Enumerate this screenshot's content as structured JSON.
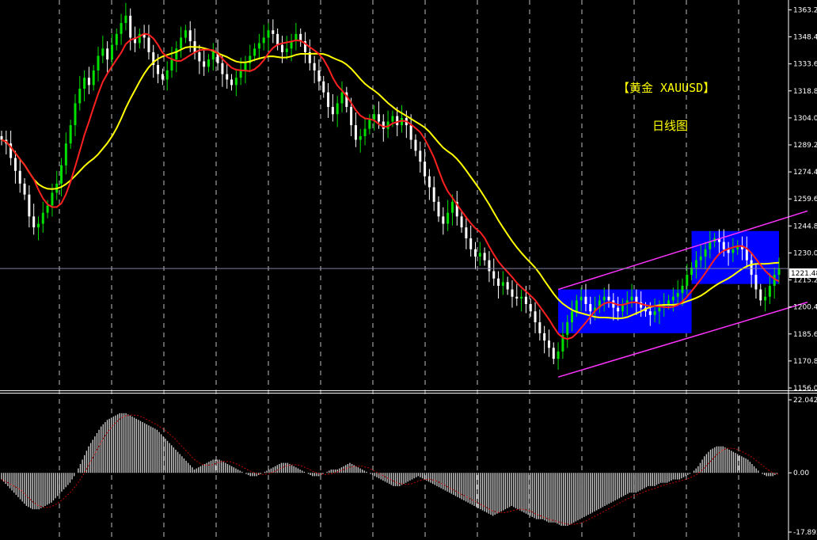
{
  "chart_data": [
    {
      "type": "candlestick",
      "title": "【黄金 XAUUSD】",
      "subtitle": "日线图",
      "y_ticks": [
        "1363.20",
        "1348.40",
        "1333.60",
        "1318.80",
        "1304.00",
        "1289.20",
        "1274.40",
        "1259.60",
        "1244.80",
        "1230.00",
        "1215.20",
        "1200.40",
        "1185.60",
        "1170.80",
        "1156.00"
      ],
      "ylim": [
        1156.0,
        1366.0
      ],
      "current_price": "1221.48",
      "close_series": [
        1292,
        1290,
        1282,
        1275,
        1268,
        1262,
        1250,
        1244,
        1246,
        1252,
        1256,
        1263,
        1268,
        1278,
        1290,
        1300,
        1312,
        1320,
        1326,
        1322,
        1330,
        1338,
        1342,
        1336,
        1344,
        1350,
        1356,
        1360,
        1348,
        1345,
        1350,
        1348,
        1340,
        1333,
        1328,
        1325,
        1330,
        1336,
        1342,
        1348,
        1352,
        1346,
        1340,
        1335,
        1332,
        1336,
        1340,
        1334,
        1328,
        1325,
        1322,
        1326,
        1330,
        1334,
        1338,
        1342,
        1345,
        1348,
        1352,
        1350,
        1344,
        1340,
        1342,
        1346,
        1350,
        1346,
        1340,
        1334,
        1330,
        1324,
        1318,
        1310,
        1306,
        1312,
        1318,
        1310,
        1300,
        1292,
        1294,
        1298,
        1303,
        1306,
        1302,
        1298,
        1302,
        1305,
        1300,
        1304,
        1300,
        1292,
        1286,
        1280,
        1272,
        1266,
        1258,
        1250,
        1246,
        1252,
        1258,
        1250,
        1244,
        1238,
        1232,
        1228,
        1230,
        1226,
        1220,
        1216,
        1212,
        1214,
        1210,
        1206,
        1205,
        1206,
        1202,
        1198,
        1192,
        1186,
        1182,
        1178,
        1172,
        1176,
        1185,
        1192,
        1198,
        1204,
        1206,
        1202,
        1198,
        1200,
        1204,
        1206,
        1204,
        1200,
        1198,
        1202,
        1204,
        1206,
        1203,
        1200,
        1198,
        1196,
        1198,
        1200,
        1202,
        1204,
        1206,
        1208,
        1212,
        1218,
        1222,
        1226,
        1228,
        1232,
        1236,
        1238,
        1236,
        1232,
        1230,
        1232,
        1234,
        1232,
        1226,
        1218,
        1210,
        1204,
        1206,
        1212,
        1218,
        1221.48
      ],
      "ma_short_color": "#ff2020",
      "ma_long_color": "#ffff00",
      "bull_color": "#00e000",
      "bear_color": "#ffffff",
      "box_color": "#0000ff",
      "channel_color": "#ff33ff",
      "bid_line_color": "#8080a0"
    },
    {
      "type": "bar",
      "y_ticks": [
        "22.042",
        "0.00",
        "-17.892"
      ],
      "ylim": [
        -17.892,
        22.042
      ],
      "values": [
        -2,
        -4,
        -6,
        -8,
        -10,
        -11,
        -11,
        -10,
        -9,
        -7,
        -5,
        -3,
        0,
        4,
        8,
        11,
        14,
        16,
        17,
        18,
        18,
        17,
        16,
        15,
        14,
        13,
        11,
        9,
        7,
        5,
        3,
        1,
        2,
        3,
        4,
        4,
        3,
        2,
        1,
        0,
        -1,
        -1,
        0,
        1,
        2,
        3,
        3,
        2,
        1,
        0,
        -1,
        -1,
        0,
        1,
        1,
        2,
        3,
        2,
        1,
        0,
        -1,
        -2,
        -3,
        -4,
        -4,
        -3,
        -2,
        -1,
        -2,
        -3,
        -4,
        -5,
        -6,
        -7,
        -8,
        -9,
        -10,
        -11,
        -12,
        -13,
        -12,
        -11,
        -10,
        -11,
        -12,
        -13,
        -14,
        -14,
        -15,
        -15,
        -16,
        -16,
        -15,
        -14,
        -13,
        -12,
        -11,
        -10,
        -9,
        -8,
        -7,
        -6,
        -6,
        -5,
        -4,
        -4,
        -3,
        -3,
        -2,
        -2,
        -1,
        0,
        2,
        5,
        7,
        8,
        8,
        7,
        6,
        5,
        4,
        2,
        0,
        -1,
        -1,
        0
      ],
      "signal_color": "#c00000",
      "bar_color": "#c8c8c8"
    }
  ]
}
